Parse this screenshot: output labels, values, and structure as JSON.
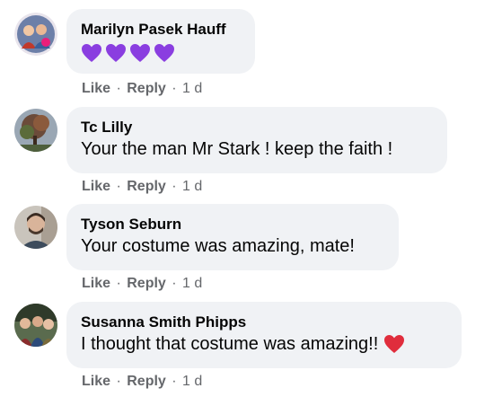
{
  "comments": [
    {
      "author": "Marilyn Pasek Hauff",
      "text": "",
      "reaction": "purple-heart-icon x4",
      "like_label": "Like",
      "reply_label": "Reply",
      "time": "1 d"
    },
    {
      "author": "Tc Lilly",
      "text": "Your the man Mr Stark ! keep the faith !",
      "like_label": "Like",
      "reply_label": "Reply",
      "time": "1 d"
    },
    {
      "author": "Tyson Seburn",
      "text": "Your costume was amazing, mate!",
      "like_label": "Like",
      "reply_label": "Reply",
      "time": "1 d"
    },
    {
      "author": "Susanna Smith Phipps",
      "text": "I thought that costume was amazing!!",
      "reaction": "red-heart-icon",
      "like_label": "Like",
      "reply_label": "Reply",
      "time": "1 d"
    }
  ],
  "colors": {
    "bubble": "#f0f2f5",
    "meta": "#65676b",
    "text": "#050505",
    "purple_heart": "#8a3ee0",
    "red_heart": "#e02d3c"
  },
  "separator": "·"
}
